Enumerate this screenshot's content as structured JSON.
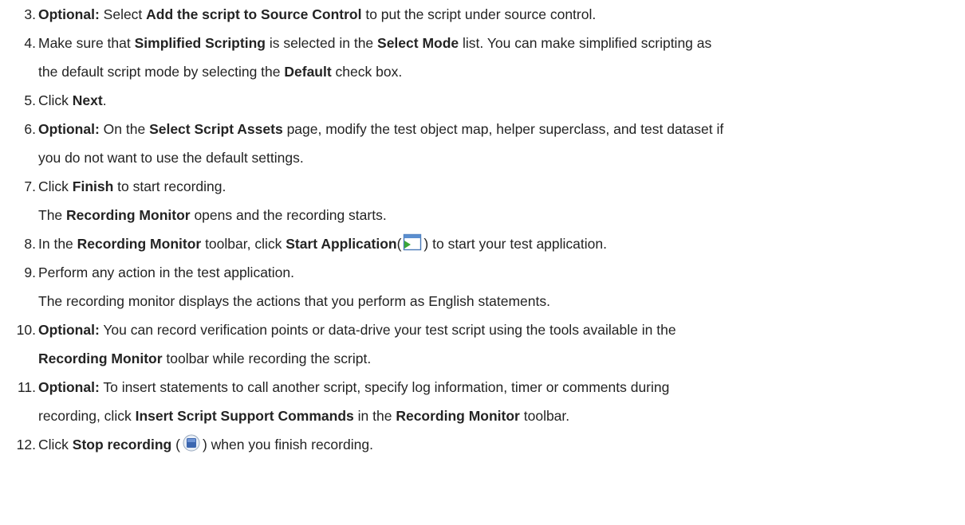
{
  "steps": [
    {
      "number": "3.",
      "lines": [
        [
          {
            "t": "Optional:",
            "b": true
          },
          {
            "t": " Select ",
            "b": false
          },
          {
            "t": "Add the script to Source Control",
            "b": true
          },
          {
            "t": " to put the script under source control.",
            "b": false
          }
        ]
      ]
    },
    {
      "number": "4.",
      "lines": [
        [
          {
            "t": "Make sure that ",
            "b": false
          },
          {
            "t": "Simplified Scripting",
            "b": true
          },
          {
            "t": " is selected in the ",
            "b": false
          },
          {
            "t": "Select Mode",
            "b": true
          },
          {
            "t": " list. You can make simplified scripting as",
            "b": false
          }
        ],
        [
          {
            "t": "the default script mode by selecting the ",
            "b": false
          },
          {
            "t": "Default",
            "b": true
          },
          {
            "t": " check box.",
            "b": false
          }
        ]
      ]
    },
    {
      "number": "5.",
      "lines": [
        [
          {
            "t": "Click ",
            "b": false
          },
          {
            "t": "Next",
            "b": true
          },
          {
            "t": ".",
            "b": false
          }
        ]
      ]
    },
    {
      "number": "6.",
      "lines": [
        [
          {
            "t": "Optional:",
            "b": true
          },
          {
            "t": " On the ",
            "b": false
          },
          {
            "t": "Select Script Assets",
            "b": true
          },
          {
            "t": " page, modify the test object map, helper superclass, and test dataset if",
            "b": false
          }
        ],
        [
          {
            "t": "you do not want to use the default settings.",
            "b": false
          }
        ]
      ]
    },
    {
      "number": "7.",
      "lines": [
        [
          {
            "t": "Click ",
            "b": false
          },
          {
            "t": "Finish",
            "b": true
          },
          {
            "t": " to start recording.",
            "b": false
          }
        ],
        [
          {
            "t": "The ",
            "b": false
          },
          {
            "t": "Recording Monitor",
            "b": true
          },
          {
            "t": " opens and the recording starts.",
            "b": false
          }
        ]
      ]
    },
    {
      "number": "8.",
      "lines": [
        [
          {
            "t": "In the ",
            "b": false
          },
          {
            "t": "Recording Monitor",
            "b": true
          },
          {
            "t": " toolbar, click ",
            "b": false
          },
          {
            "t": "Start Application",
            "b": true
          },
          {
            "t": "(",
            "b": false
          },
          {
            "icon": "start-application-icon"
          },
          {
            "t": ") to start your test application.",
            "b": false
          }
        ]
      ]
    },
    {
      "number": "9.",
      "lines": [
        [
          {
            "t": "Perform any action in the test application.",
            "b": false
          }
        ],
        [
          {
            "t": "The recording monitor displays the actions that you perform as English statements.",
            "b": false
          }
        ]
      ]
    },
    {
      "number": "10.",
      "lines": [
        [
          {
            "t": "Optional:",
            "b": true
          },
          {
            "t": " You can record verification points or data-drive your test script using the tools available in the",
            "b": false
          }
        ],
        [
          {
            "t": "Recording Monitor",
            "b": true
          },
          {
            "t": " toolbar while recording the script.",
            "b": false
          }
        ]
      ]
    },
    {
      "number": "11.",
      "lines": [
        [
          {
            "t": "Optional:",
            "b": true
          },
          {
            "t": " To insert statements to call another script, specify log information, timer or comments during",
            "b": false
          }
        ],
        [
          {
            "t": "recording, click ",
            "b": false
          },
          {
            "t": "Insert Script Support Commands",
            "b": true
          },
          {
            "t": " in the ",
            "b": false
          },
          {
            "t": "Recording Monitor",
            "b": true
          },
          {
            "t": " toolbar.",
            "b": false
          }
        ]
      ]
    },
    {
      "number": "12.",
      "lines": [
        [
          {
            "t": "Click ",
            "b": false
          },
          {
            "t": "Stop recording",
            "b": true
          },
          {
            "t": " (",
            "b": false
          },
          {
            "icon": "stop-recording-icon"
          },
          {
            "t": ") when you finish recording.",
            "b": false
          }
        ]
      ]
    }
  ]
}
